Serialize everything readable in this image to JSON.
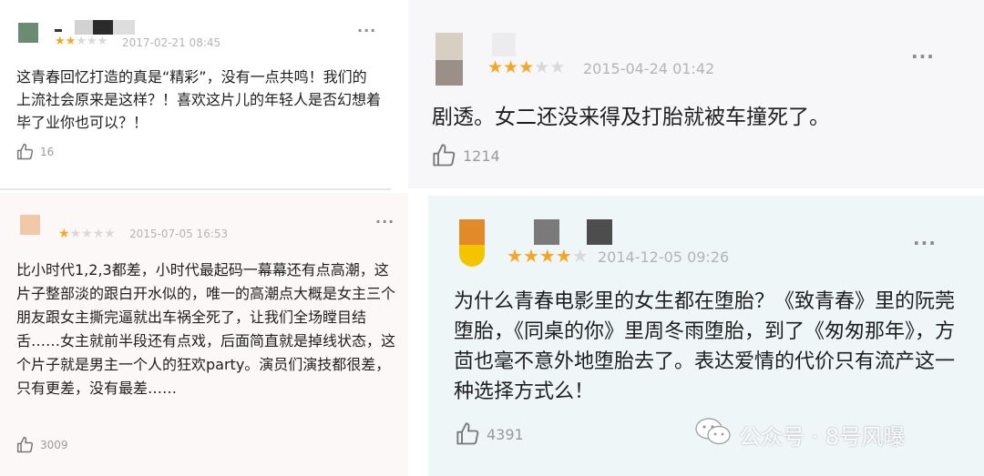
{
  "colors": {
    "star_on": "#f5a623",
    "star_off": "#d9d9d9",
    "meta": "#b4b4b4"
  },
  "reviews": [
    {
      "rating": 2,
      "max_rating": 5,
      "date": "2017-02-21 08:45",
      "text": "这青春回忆打造的真是“精彩”，没有一点共鸣！我们的上流社会原来是这样？！喜欢这片儿的年轻人是否幻想着毕了业你也可以？！",
      "likes": "16",
      "more_icon": "more-dots-icon",
      "like_icon": "thumbs-up-icon"
    },
    {
      "rating": 3,
      "max_rating": 5,
      "date": "2015-04-24 01:42",
      "text": "剧透。女二还没来得及打胎就被车撞死了。",
      "likes": "1214",
      "more_icon": "more-dots-icon",
      "like_icon": "thumbs-up-icon"
    },
    {
      "rating": 1,
      "max_rating": 5,
      "date": "2015-07-05 16:53",
      "text": "比小时代1,2,3都差，小时代最起码一幕幕还有点高潮，这片子整部淡的跟白开水似的，唯一的高潮点大概是女主三个朋友跟女主撕完逼就出车祸全死了，让我们全场瞠目结舌……女主就前半段还有点戏，后面简直就是掉线状态，这个片子就是男主一个人的狂欢party。演员们演技都很差，只有更差，没有最差……",
      "likes": "3009",
      "more_icon": "more-dots-icon",
      "like_icon": "thumbs-up-icon"
    },
    {
      "rating": 4,
      "max_rating": 5,
      "date": "2014-12-05 09:26",
      "text": "为什么青春电影里的女生都在堕胎？《致青春》里的阮莞堕胎，《同桌的你》里周冬雨堕胎，到了《匆匆那年》，方茴也毫不意外地堕胎去了。表达爱情的代价只有流产这一种选择方式么！",
      "likes": "4391",
      "more_icon": "more-dots-icon",
      "like_icon": "thumbs-up-icon"
    }
  ],
  "watermark": {
    "text": "公众号 · 8号风曝",
    "icon": "wechat-icon"
  }
}
